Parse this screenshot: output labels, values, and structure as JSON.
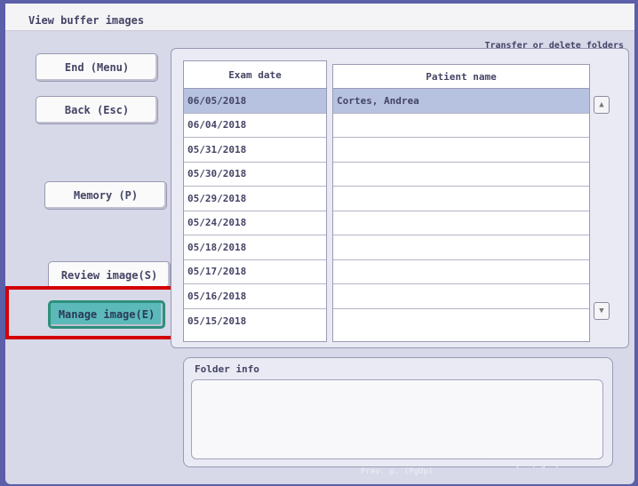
{
  "window": {
    "title": "View buffer images",
    "subtitle": "Transfer or delete folders"
  },
  "buttons": {
    "end": "End (Menu)",
    "back": "Back (Esc)",
    "memory": "Memory (P)",
    "review": "Review image(S)",
    "manage": "Manage image(E)"
  },
  "table": {
    "columns": [
      "Exam date",
      "Patient name"
    ],
    "rows": [
      {
        "date": "06/05/2018",
        "name": "Cortes, Andrea"
      },
      {
        "date": "06/04/2018",
        "name": ""
      },
      {
        "date": "05/31/2018",
        "name": ""
      },
      {
        "date": "05/30/2018",
        "name": ""
      },
      {
        "date": "05/29/2018",
        "name": ""
      },
      {
        "date": "05/24/2018",
        "name": ""
      },
      {
        "date": "05/18/2018",
        "name": ""
      },
      {
        "date": "05/17/2018",
        "name": ""
      },
      {
        "date": "05/16/2018",
        "name": ""
      },
      {
        "date": "05/15/2018",
        "name": ""
      }
    ],
    "selected_index": 0
  },
  "folder_info": {
    "label": "Folder info"
  },
  "pager": {
    "prev": "Prev. p. (PgUp)",
    "next": "Next p. (PgDn)"
  },
  "icons": {
    "scroll_up": "scroll-up-arrow-icon",
    "scroll_down": "scroll-down-arrow-icon"
  },
  "colors": {
    "selected_row": "#b6c2e0",
    "active_button": "#5bb9b9",
    "highlight_box": "#d40000"
  }
}
